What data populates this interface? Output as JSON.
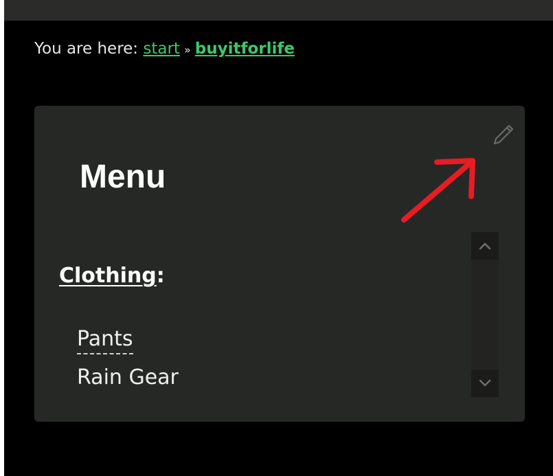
{
  "breadcrumb": {
    "prefix": "You are here: ",
    "start_link": "start",
    "separator": "»",
    "current_link": "buyitforlife"
  },
  "panel": {
    "title": "Menu",
    "section_heading": "Clothing",
    "section_colon": ":",
    "items": [
      {
        "label": "Pants"
      },
      {
        "label": "Rain Gear"
      }
    ]
  },
  "icons": {
    "edit": "pencil-icon",
    "annotation": "red-arrow-icon",
    "scroll_up": "chevron-up-icon",
    "scroll_down": "chevron-down-icon"
  },
  "colors": {
    "link": "#3cc96a",
    "panel_bg": "#262826",
    "annotation": "#e81c24"
  }
}
